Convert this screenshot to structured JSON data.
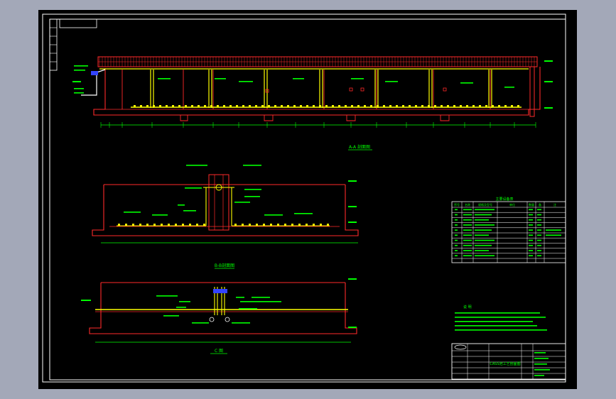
{
  "sheet": {
    "background": "#000000",
    "frame_color": "#ffffff"
  },
  "sections": {
    "aa_title": "A-A 剖面图",
    "bb_title": "B-B剖面图",
    "cc_title": "C 图"
  },
  "legend": {
    "title": "主要设备表",
    "header": [
      "序号",
      "名称",
      "规格及型号",
      "单位",
      "数量",
      "备",
      "注"
    ]
  },
  "notes": {
    "title": "说 明"
  },
  "title_block": {
    "drawing_title": "CASS池工艺剖面图"
  },
  "colors": {
    "wall": "#ff2a2a",
    "pipe": "#ffff00",
    "text": "#00ff00",
    "dim": "#00ffff",
    "accent": "#ff00ff",
    "blue": "#3344ff"
  }
}
